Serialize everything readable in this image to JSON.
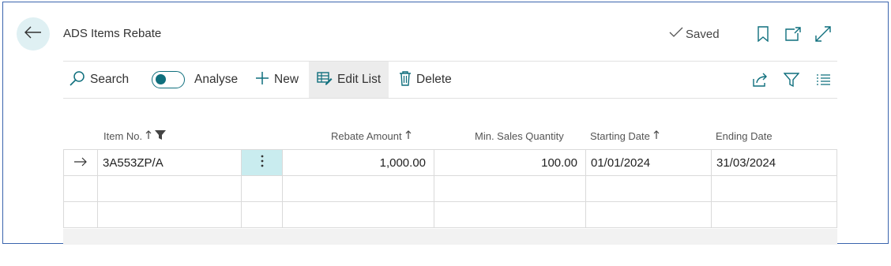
{
  "page": {
    "title": "ADS Items Rebate",
    "saved_label": "Saved"
  },
  "toolbar": {
    "search_label": "Search",
    "analyse_label": "Analyse",
    "new_label": "New",
    "edit_list_label": "Edit List",
    "delete_label": "Delete"
  },
  "columns": {
    "item_no": "Item No.",
    "rebate_amount": "Rebate Amount",
    "min_sales_quantity": "Min. Sales Quantity",
    "starting_date": "Starting Date",
    "ending_date": "Ending Date"
  },
  "rows": [
    {
      "item_no": "3A553ZP/A",
      "rebate_amount": "1,000.00",
      "min_sales_quantity": "100.00",
      "starting_date": "01/01/2024",
      "ending_date": "31/03/2024"
    }
  ],
  "colors": {
    "accent": "#0f6f7d",
    "frame_border": "#3a64ad",
    "selected_cell": "#c9ecef",
    "back_button_bg": "#dff0f3"
  },
  "icons": [
    "back-arrow-icon",
    "checkmark-icon",
    "bookmark-icon",
    "open-in-new-window-icon",
    "expand-icon",
    "search-icon",
    "plus-icon",
    "edit-list-icon",
    "trash-icon",
    "share-icon",
    "filter-icon",
    "list-view-icon",
    "sort-ascending-icon",
    "column-filter-icon",
    "row-arrow-icon",
    "more-options-icon"
  ]
}
